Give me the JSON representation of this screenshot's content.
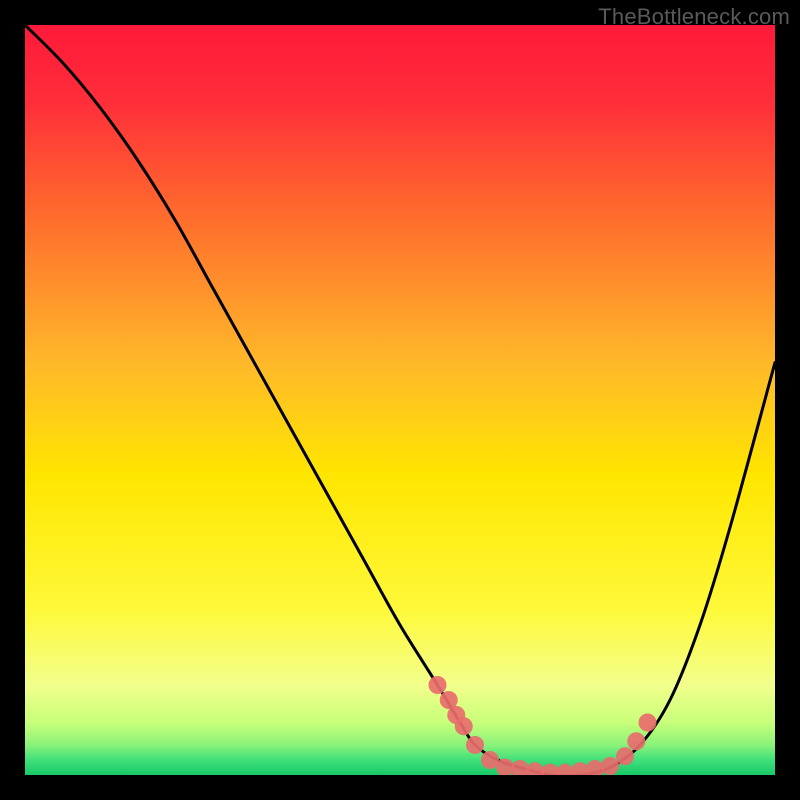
{
  "watermark": "TheBottleneck.com",
  "colors": {
    "bg": "#000000",
    "top": "#ff1a3a",
    "mid_upper": "#ff7a2a",
    "mid": "#ffe600",
    "lower": "#f5ff8a",
    "bottom": "#1fe07a",
    "curve": "#000000",
    "marker": "#e86d6d"
  },
  "chart_data": {
    "type": "line",
    "title": "",
    "xlabel": "",
    "ylabel": "",
    "xlim": [
      0,
      100
    ],
    "ylim": [
      0,
      100
    ],
    "curve": {
      "x": [
        0,
        5,
        10,
        15,
        20,
        25,
        30,
        35,
        40,
        45,
        50,
        55,
        58,
        60,
        63,
        66,
        70,
        74,
        78,
        82,
        86,
        90,
        94,
        100
      ],
      "y": [
        100,
        95,
        89,
        82,
        74,
        65,
        56,
        47,
        38,
        29,
        20,
        12,
        7,
        4,
        2,
        1,
        0,
        0,
        1,
        4,
        10,
        20,
        33,
        55
      ]
    },
    "markers": {
      "x": [
        55,
        56.5,
        57.5,
        58.5,
        60,
        62,
        64,
        66,
        68,
        70,
        72,
        74,
        76,
        78,
        80,
        81.5,
        83
      ],
      "y": [
        12,
        10,
        8,
        6.5,
        4,
        2,
        1,
        0.8,
        0.5,
        0.3,
        0.3,
        0.5,
        0.8,
        1.2,
        2.5,
        4.5,
        7
      ]
    }
  }
}
